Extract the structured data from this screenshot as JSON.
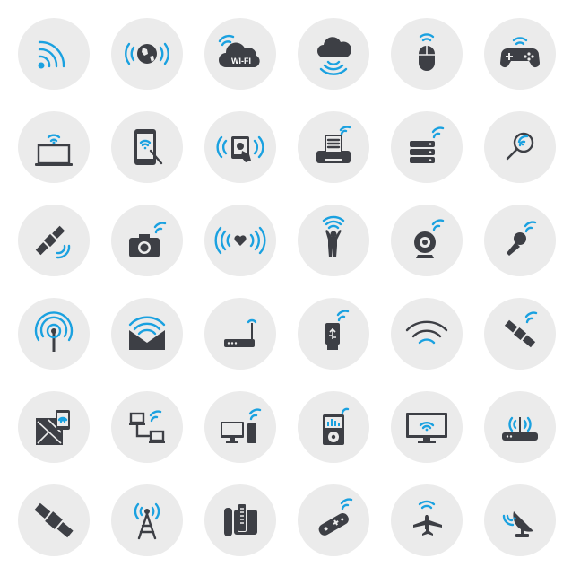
{
  "icon_set": {
    "accent_color": "#1aa1e0",
    "dark_color": "#3d3f45",
    "tile_color": "#ebebeb",
    "rows": [
      [
        "wifi-signal-icon",
        "globe-wifi-icon",
        "wifi-cloud-icon",
        "cloud-broadcast-icon",
        "wireless-mouse-icon",
        "wireless-gamepad-icon"
      ],
      [
        "laptop-wifi-icon",
        "tablet-stylus-icon",
        "touch-device-wifi-icon",
        "wireless-printer-icon",
        "server-wifi-icon",
        "magnifier-signal-icon"
      ],
      [
        "satellite-signal-icon",
        "wireless-camera-icon",
        "heart-broadcast-icon",
        "person-hotspot-icon",
        "webcam-wifi-icon",
        "wireless-microphone-icon"
      ],
      [
        "antenna-broadcast-icon",
        "envelope-wifi-icon",
        "router-icon",
        "usb-wireless-icon",
        "wifi-symbol-icon",
        "satellite-orbit-icon"
      ],
      [
        "map-phone-wifi-icon",
        "network-computers-icon",
        "desktop-wifi-icon",
        "media-player-wifi-icon",
        "monitor-wifi-icon",
        "wifi-router-antenna-icon"
      ],
      [
        "satellite-icon",
        "radio-tower-icon",
        "cordless-phone-icon",
        "remote-control-icon",
        "airplane-wifi-icon",
        "satellite-dish-icon"
      ]
    ]
  },
  "wifi_badge_text": "WI-FI"
}
